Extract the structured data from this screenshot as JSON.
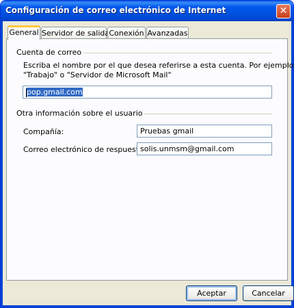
{
  "window": {
    "title": "Configuración de correo electrónico de Internet",
    "close_label": "✕"
  },
  "tabs": [
    {
      "label": "General",
      "active": true
    },
    {
      "label": "Servidor de salida",
      "active": false
    },
    {
      "label": "Conexión",
      "active": false
    },
    {
      "label": "Avanzadas",
      "active": false
    }
  ],
  "account_group": {
    "title": "Cuenta de correo",
    "description_line1": "Escriba el nombre por el que desea referirse a esta cuenta. Por ejemplo:",
    "description_line2": "\"Trabajo\" o \"Servidor de Microsoft Mail\"",
    "account_name_value": "pop.gmail.com"
  },
  "user_group": {
    "title": "Otra información sobre el usuario",
    "company_label": "Compañía:",
    "company_value": "Pruebas gmail",
    "reply_label": "Correo electrónico de respuesta:",
    "reply_value": "solis.unmsm@gmail.com"
  },
  "buttons": {
    "ok_label": "Aceptar",
    "cancel_label": "Cancelar"
  },
  "colors": {
    "titlebar": "#0058ee",
    "dialog_bg": "#ece9d8",
    "panel_bg": "#fcfcfe",
    "selection": "#316ac5",
    "active_tab_accent": "#ffc83c"
  }
}
